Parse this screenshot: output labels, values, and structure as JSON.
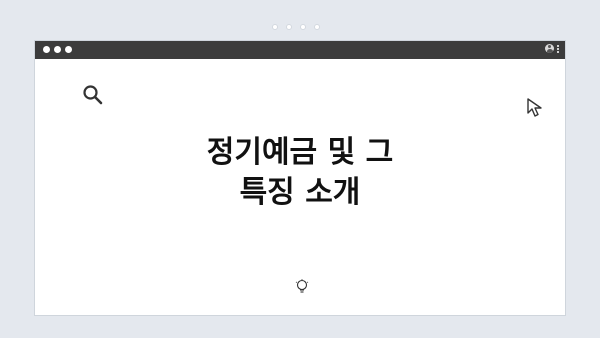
{
  "window": {
    "title_lines": [
      "정기예금 및 그",
      "특징 소개"
    ]
  },
  "icons": {
    "search": "search-icon",
    "cursor": "cursor-icon",
    "bulb": "lightbulb-icon",
    "avatar": "avatar-icon",
    "menu": "kebab-menu-icon"
  },
  "colors": {
    "background": "#e4e8ee",
    "titlebar": "#3c3c3c",
    "window": "#ffffff",
    "text": "#111111"
  }
}
